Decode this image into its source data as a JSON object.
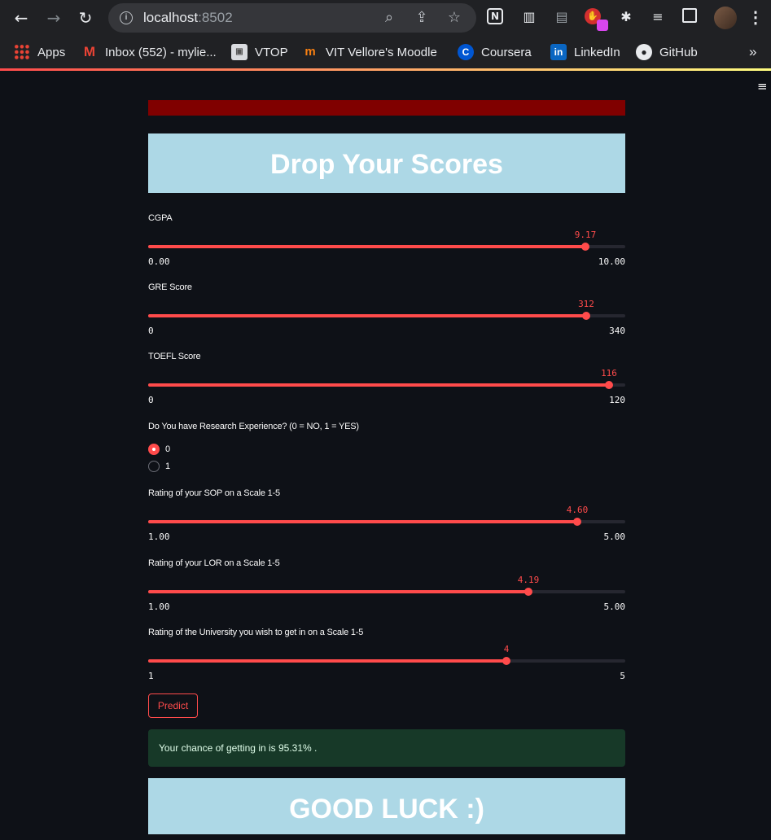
{
  "browser": {
    "url_host": "localhost",
    "url_port": ":8502",
    "bookmarks": [
      "Apps",
      "Inbox (552) - mylie...",
      "VTOP",
      "VIT Vellore's Moodle",
      "Coursera",
      "LinkedIn",
      "GitHub"
    ],
    "more": "»"
  },
  "app": {
    "title": "Drop Your Scores",
    "sliders": [
      {
        "label": "CGPA",
        "value": "9.17",
        "min": "0.00",
        "max": "10.00",
        "fraction": 0.917
      },
      {
        "label": "GRE Score",
        "value": "312",
        "min": "0",
        "max": "340",
        "fraction": 0.9176
      },
      {
        "label": "TOEFL Score",
        "value": "116",
        "min": "0",
        "max": "120",
        "fraction": 0.9667
      },
      {
        "label": "Rating of your SOP on a Scale 1-5",
        "value": "4.60",
        "min": "1.00",
        "max": "5.00",
        "fraction": 0.9
      },
      {
        "label": "Rating of your LOR on a Scale 1-5",
        "value": "4.19",
        "min": "1.00",
        "max": "5.00",
        "fraction": 0.7975
      },
      {
        "label": "Rating of the University you wish to get in on a Scale 1-5",
        "value": "4",
        "min": "1",
        "max": "5",
        "fraction": 0.75
      }
    ],
    "research": {
      "label": "Do You have Research Experience? (0 = NO, 1 = YES)",
      "options": [
        "0",
        "1"
      ],
      "selected": "0"
    },
    "predict_label": "Predict",
    "result": "Your chance of getting in is 95.31% .",
    "footer_title": "GOOD LUCK :)"
  },
  "colors": {
    "primary": "#ff4b4b",
    "banner": "#800000",
    "title_bg": "#add8e6",
    "success_bg": "#173928"
  }
}
